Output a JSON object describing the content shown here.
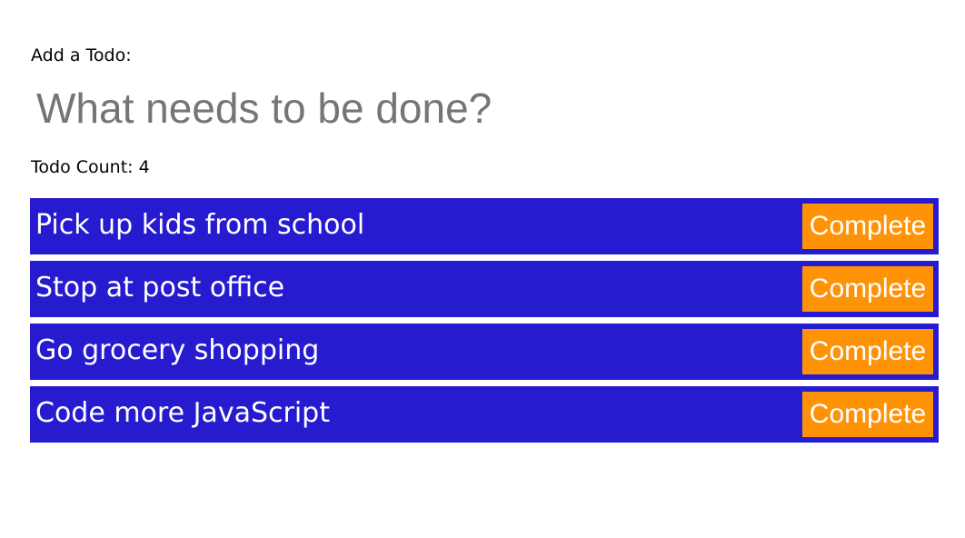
{
  "add_label": "Add a Todo:",
  "input": {
    "placeholder": "What needs to be done?",
    "value": ""
  },
  "count": {
    "label": "Todo Count: ",
    "value": "4"
  },
  "todos": [
    {
      "text": "Pick up kids from school",
      "button": "Complete"
    },
    {
      "text": "Stop at post office",
      "button": "Complete"
    },
    {
      "text": "Go grocery shopping",
      "button": "Complete"
    },
    {
      "text": "Code more JavaScript",
      "button": "Complete"
    }
  ],
  "colors": {
    "item_background": "#261bcf",
    "button_background": "#ff9307",
    "text_on_item": "#ffffff",
    "placeholder": "#757575"
  }
}
